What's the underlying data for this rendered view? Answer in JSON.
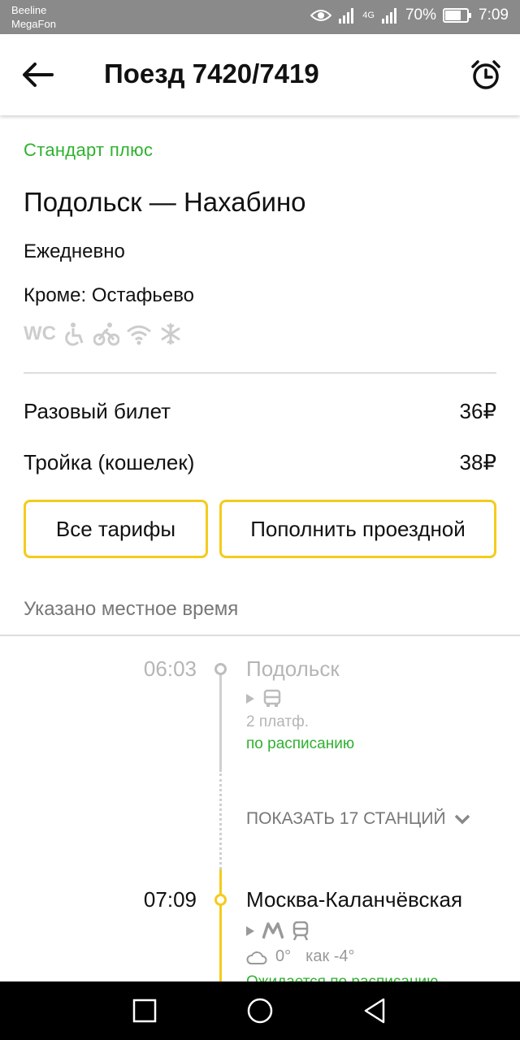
{
  "status": {
    "carrier1": "Beeline",
    "carrier2": "MegaFon",
    "network": "4G",
    "battery": "70%",
    "time": "7:09"
  },
  "header": {
    "title": "Поезд 7420/7419"
  },
  "train": {
    "tariff_class": "Стандарт плюс",
    "route": "Подольск — Нахабино",
    "days": "Ежедневно",
    "except": "Кроме: Остафьево",
    "amenities": [
      "wc-icon",
      "wheelchair-icon",
      "bicycle-icon",
      "wifi-icon",
      "snowflake-icon"
    ],
    "wc_label": "WC"
  },
  "prices": [
    {
      "label": "Разовый билет",
      "value": "36₽"
    },
    {
      "label": "Тройка (кошелек)",
      "value": "38₽"
    }
  ],
  "buttons": {
    "all_fares": "Все тарифы",
    "top_up": "Пополнить проездной"
  },
  "note": "Указано местное время",
  "stops": [
    {
      "time": "06:03",
      "name": "Подольск",
      "platform": "2 платф.",
      "status": "по расписанию",
      "transfers": [
        "play-icon",
        "bus-icon"
      ]
    },
    {
      "time": "07:09",
      "name": "Москва-Каланчёвская",
      "weather_temp": "0°",
      "weather_feels": "как -4°",
      "status": "Ожидается по расписанию",
      "transfers": [
        "play-icon",
        "metro-icon",
        "train-icon"
      ]
    }
  ],
  "show_stations": "ПОКАЗАТЬ 17 СТАНЦИЙ",
  "colors": {
    "accent_green": "#2fb12f",
    "button_border": "#f3cc1c",
    "timeline_yellow": "#f3cc1c",
    "muted": "#b5b5b5"
  }
}
